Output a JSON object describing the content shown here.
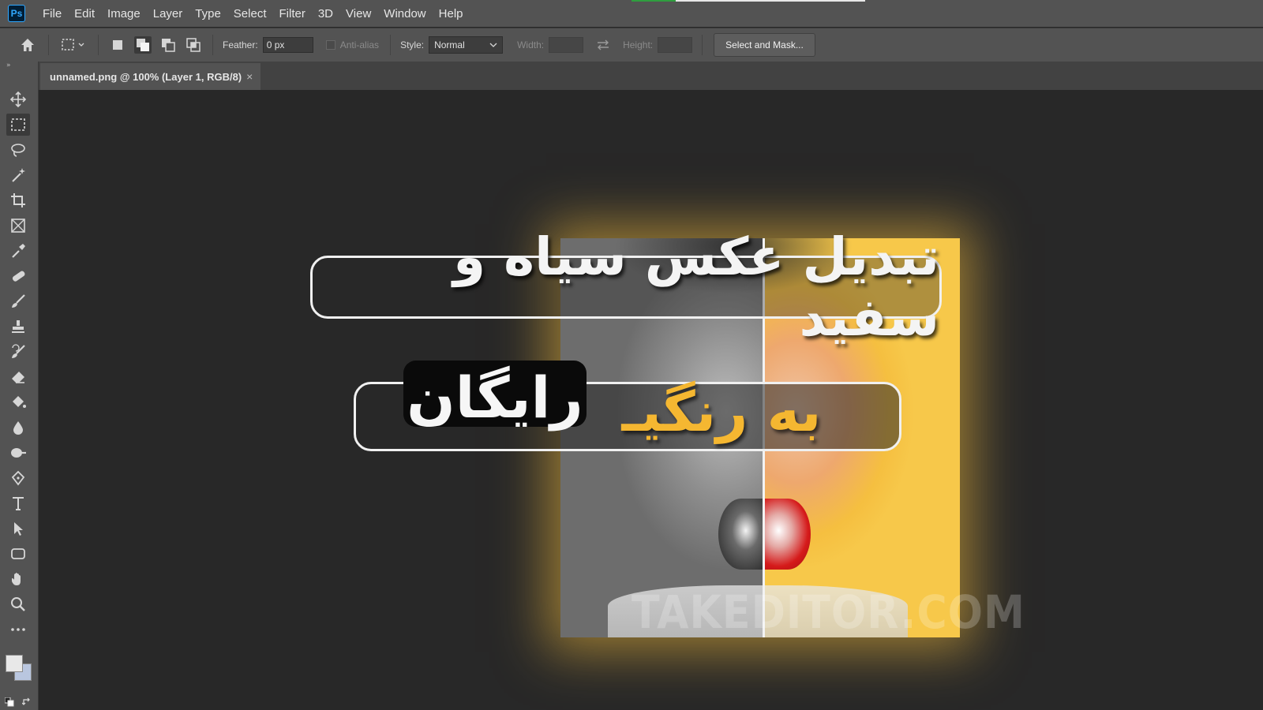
{
  "app": {
    "logo_text": "Ps"
  },
  "menu": [
    "File",
    "Edit",
    "Image",
    "Layer",
    "Type",
    "Select",
    "Filter",
    "3D",
    "View",
    "Window",
    "Help"
  ],
  "options": {
    "feather_label": "Feather:",
    "feather_value": "0 px",
    "anti_alias_label": "Anti-alias",
    "style_label": "Style:",
    "style_value": "Normal",
    "width_label": "Width:",
    "height_label": "Height:",
    "select_mask_label": "Select and Mask..."
  },
  "document": {
    "tab_title": "unnamed.png @ 100% (Layer 1, RGB/8)",
    "close_glyph": "×"
  },
  "artwork": {
    "title_line": "تبدیل عکس سیاه و سفید",
    "subtitle_colored": "به رنگیـ",
    "subtitle_free": "رایگان",
    "watermark": "TAKEDITOR.COM"
  },
  "colors": {
    "accent_yellow": "#f5b731",
    "foreground_swatch": "#e8e8e8",
    "background_swatch": "#b9c6df",
    "ps_blue": "#31a8ff"
  },
  "tools": [
    "move-tool",
    "rectangular-marquee-tool",
    "lasso-tool",
    "magic-wand-tool",
    "crop-tool",
    "frame-tool",
    "eyedropper-tool",
    "healing-brush-tool",
    "brush-tool",
    "clone-stamp-tool",
    "history-brush-tool",
    "eraser-tool",
    "paint-bucket-tool",
    "blur-tool",
    "dodge-tool",
    "pen-tool",
    "type-tool",
    "path-selection-tool",
    "rectangle-tool",
    "hand-tool",
    "zoom-tool",
    "more-tools"
  ]
}
